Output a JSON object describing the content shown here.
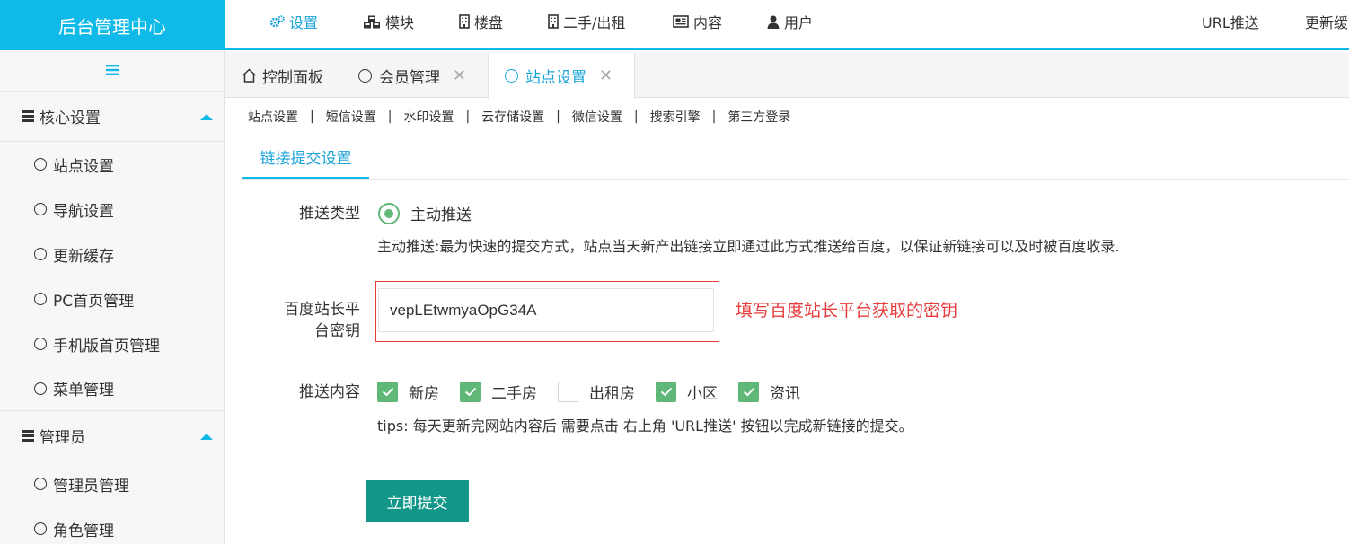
{
  "app": {
    "title": "后台管理中心"
  },
  "topnav": {
    "items": [
      {
        "label": "设置",
        "icon": "gears-icon"
      },
      {
        "label": "模块",
        "icon": "cubes-icon"
      },
      {
        "label": "楼盘",
        "icon": "building-icon"
      },
      {
        "label": "二手/出租",
        "icon": "building-icon"
      },
      {
        "label": "内容",
        "icon": "newspaper-icon"
      },
      {
        "label": "用户",
        "icon": "user-icon"
      }
    ],
    "url_push": "URL推送",
    "refresh_cache": "更新缓"
  },
  "sidebar": {
    "groups": [
      {
        "label": "核心设置",
        "items": [
          "站点设置",
          "导航设置",
          "更新缓存",
          "PC首页管理",
          "手机版首页管理",
          "菜单管理"
        ]
      },
      {
        "label": "管理员",
        "items": [
          "管理员管理",
          "角色管理"
        ]
      }
    ]
  },
  "tabs": [
    {
      "label": "控制面板"
    },
    {
      "label": "会员管理"
    },
    {
      "label": "站点设置"
    }
  ],
  "subnav": [
    "站点设置",
    "短信设置",
    "水印设置",
    "云存储设置",
    "微信设置",
    "搜索引擎",
    "第三方登录"
  ],
  "subtab": "链接提交设置",
  "form": {
    "push_type_label": "推送类型",
    "push_type_option": "主动推送",
    "push_type_help": "主动推送:最为快速的提交方式，站点当天新产出链接立即通过此方式推送给百度，以保证新链接可以及时被百度收录.",
    "key_label_line1": "百度站长平",
    "key_label_line2": "台密钥",
    "key_value": "vepLEtwmyaOpG34A",
    "key_annotation": "填写百度站长平台获取的密钥",
    "content_label": "推送内容",
    "content_options": [
      {
        "label": "新房",
        "checked": true
      },
      {
        "label": "二手房",
        "checked": true
      },
      {
        "label": "出租房",
        "checked": false
      },
      {
        "label": "小区",
        "checked": true
      },
      {
        "label": "资讯",
        "checked": true
      }
    ],
    "tips": "tips: 每天更新完网站内容后 需要点击 右上角 'URL推送' 按钮以完成新链接的提交。",
    "submit_label": "立即提交"
  },
  "colors": {
    "brand": "#0fb9e8",
    "active_text": "#1aa3d9",
    "check_green": "#5fb878",
    "submit_teal": "#119688",
    "annotation_red": "#e63c3c"
  }
}
